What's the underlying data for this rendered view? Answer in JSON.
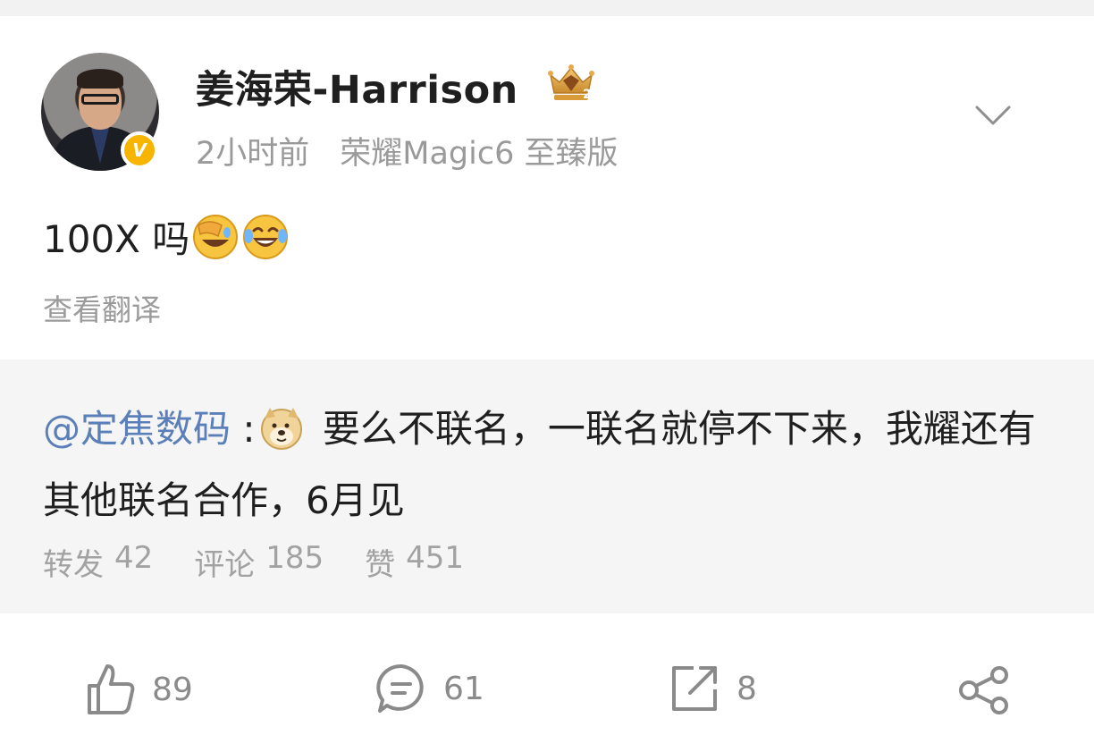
{
  "post": {
    "author": {
      "name": "姜海荣-Harrison",
      "verified_badge": "V",
      "rank_icon": "crown-rank-2-icon",
      "badge_color": "#f7b500"
    },
    "time": "2小时前",
    "device": "荣耀Magic6 至臻版",
    "text": "100X 吗",
    "emojis": [
      "facepalm-laugh-emoji",
      "tears-of-joy-emoji"
    ],
    "translate_label": "查看翻译"
  },
  "quoted": {
    "mention": "@定焦数码",
    "colon": " :",
    "emoji": "doge-emoji",
    "text": " 要么不联名，一联名就停不下来，我耀还有其他联名合作，6月见",
    "stats": {
      "repost_label": "转发",
      "repost_count": "42",
      "comment_label": "评论",
      "comment_count": "185",
      "like_label": "赞",
      "like_count": "451"
    },
    "mention_color": "#5b7fb8"
  },
  "actions": {
    "like_count": "89",
    "comment_count": "61",
    "repost_count": "8"
  }
}
